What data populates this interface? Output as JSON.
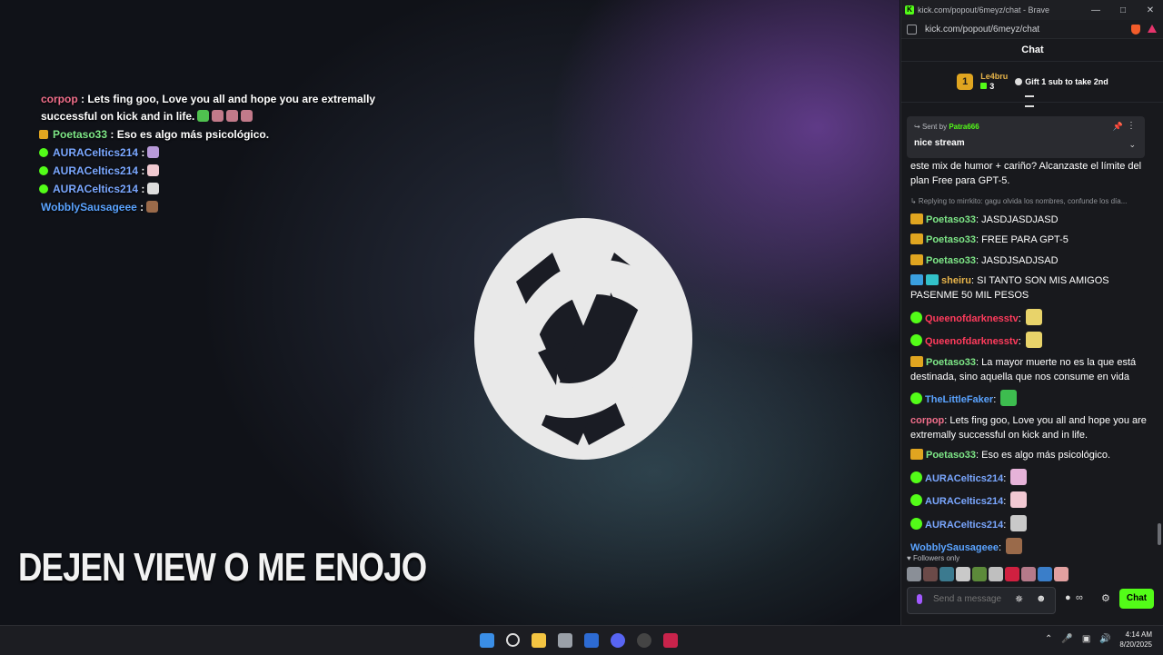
{
  "stream": {
    "overlay_messages": [
      {
        "user": "corpop",
        "text": " : Lets fing goo, Love you all and hope you are extremally successful on kick and in life.",
        "user_color": "#f06e8a",
        "badge": "none"
      },
      {
        "user": "Poetaso33",
        "text": " : Eso es algo más psicológico.",
        "user_color": "#7ee787",
        "badge": "crown"
      },
      {
        "user": "AURACeltics214",
        "text": " :",
        "user_color": "#7aa7ff",
        "badge": "verified"
      },
      {
        "user": "AURACeltics214",
        "text": " :",
        "user_color": "#7aa7ff",
        "badge": "verified"
      },
      {
        "user": "AURACeltics214",
        "text": " :",
        "user_color": "#7aa7ff",
        "badge": "verified"
      },
      {
        "user": "WobblySausageee",
        "text": " :",
        "user_color": "#5aa3ff",
        "badge": "none"
      }
    ],
    "banner_text": "DEJEN VIEW O ME ENOJO"
  },
  "browser": {
    "title": "kick.com/popout/6meyz/chat - Brave",
    "url": "kick.com/popout/6meyz/chat"
  },
  "chat": {
    "header": "Chat",
    "top_gifter": {
      "rank": "1",
      "name": "Le4bru",
      "count": "3"
    },
    "gift_prompt": "Gift 1 sub to take 2nd",
    "pinned": {
      "sent_by_label": "Sent by",
      "sent_by": "Patra666",
      "message": "nice stream"
    },
    "messages": [
      {
        "user": "",
        "text": "este mix de humor + cariño? Alcanzaste el límite del plan Free para GPT-5.",
        "user_color": "#ffffff",
        "badges": []
      },
      {
        "reply": "Replying to mirrkito: gagu olvida los nombres, confunde los día..."
      },
      {
        "user": "Poetaso33",
        "text": "JASDJASDJASD",
        "user_color": "#7ee787",
        "badges": [
          "crown"
        ]
      },
      {
        "user": "Poetaso33",
        "text": "FREE PARA GPT-5",
        "user_color": "#7ee787",
        "badges": [
          "crown"
        ]
      },
      {
        "user": "Poetaso33",
        "text": "JASDJSADJSAD",
        "user_color": "#7ee787",
        "badges": [
          "crown"
        ]
      },
      {
        "user": "sheiru",
        "text": "SI TANTO SON MIS AMIGOS PASENME 50 MIL PESOS",
        "user_color": "#e7b44a",
        "badges": [
          "blue",
          "teal"
        ]
      },
      {
        "user": "Queenofdarknesstv",
        "text": "",
        "user_color": "#ff3b5c",
        "badges": [
          "verified"
        ],
        "emote": "#e8d36a"
      },
      {
        "user": "Queenofdarknesstv",
        "text": "",
        "user_color": "#ff3b5c",
        "badges": [
          "verified"
        ],
        "emote": "#e8d36a"
      },
      {
        "user": "Poetaso33",
        "text": "La mayor muerte no es la que está destinada, sino aquella que nos consume en vida",
        "user_color": "#7ee787",
        "badges": [
          "crown"
        ]
      },
      {
        "user": "TheLittleFaker",
        "text": "",
        "user_color": "#5aa3ff",
        "badges": [
          "verified"
        ],
        "emote": "#3dbd4f"
      },
      {
        "user": "corpop",
        "text": "Lets fing goo, Love you all and hope you are extremally successful on kick and in life.",
        "user_color": "#f06e8a",
        "badges": []
      },
      {
        "user": "Poetaso33",
        "text": "Eso es algo más psicológico.",
        "user_color": "#7ee787",
        "badges": [
          "crown"
        ]
      },
      {
        "user": "AURACeltics214",
        "text": "",
        "user_color": "#7aa7ff",
        "badges": [
          "verified"
        ],
        "emote": "#e6b3d9"
      },
      {
        "user": "AURACeltics214",
        "text": "",
        "user_color": "#7aa7ff",
        "badges": [
          "verified"
        ],
        "emote": "#f2c9d3"
      },
      {
        "user": "AURACeltics214",
        "text": "",
        "user_color": "#7aa7ff",
        "badges": [
          "verified"
        ],
        "emote": "#c9c9c9"
      },
      {
        "user": "WobblySausageee",
        "text": "",
        "user_color": "#5aa3ff",
        "badges": [],
        "emote": "#9a6a4a"
      }
    ],
    "followers_only": "Followers only",
    "input_placeholder": "Send a message",
    "send_label": "Chat"
  },
  "taskbar": {
    "time": "4:14 AM",
    "date": "8/20/2025"
  }
}
